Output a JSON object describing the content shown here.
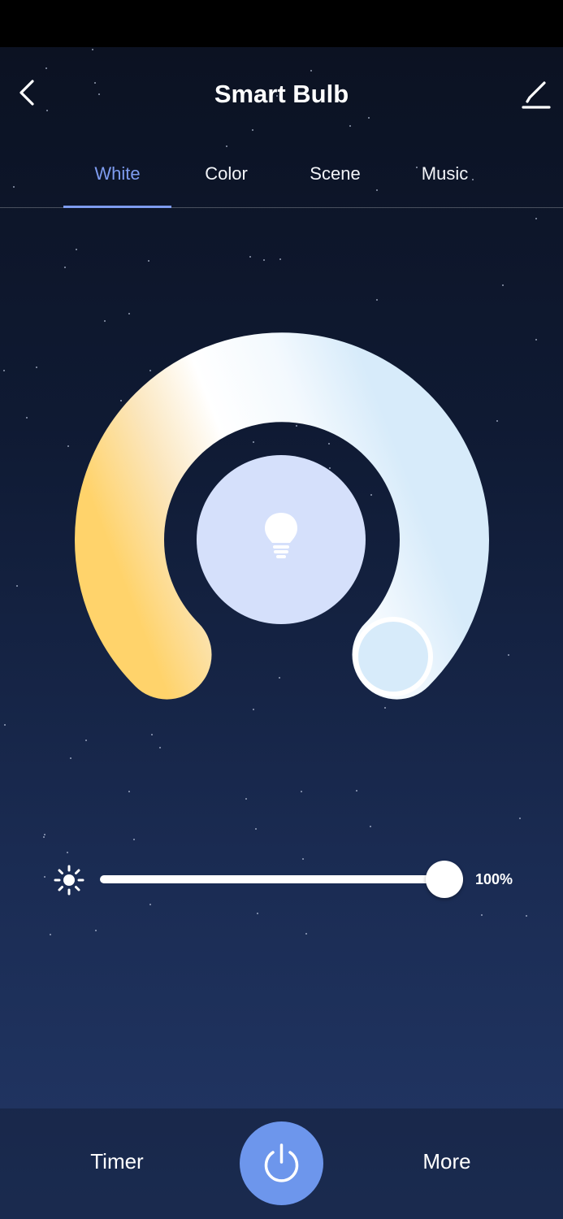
{
  "header": {
    "title": "Smart Bulb"
  },
  "tabs": [
    {
      "label": "White",
      "active": true
    },
    {
      "label": "Color",
      "active": false
    },
    {
      "label": "Scene",
      "active": false
    },
    {
      "label": "Music",
      "active": false
    }
  ],
  "brightness": {
    "value": 1.0,
    "label": "100%"
  },
  "colors": {
    "accent": "#7e9cf0",
    "power_button": "#6d96ec",
    "bulb_circle": "#d5e0fb",
    "warm_end": "#ffd36b",
    "cool_end": "#d7ebfa"
  },
  "icons": [
    "back-arrow-icon",
    "edit-pencil-icon",
    "bulb-icon",
    "sun-icon",
    "power-icon"
  ],
  "bottom_bar": {
    "timer_label": "Timer",
    "more_label": "More"
  }
}
